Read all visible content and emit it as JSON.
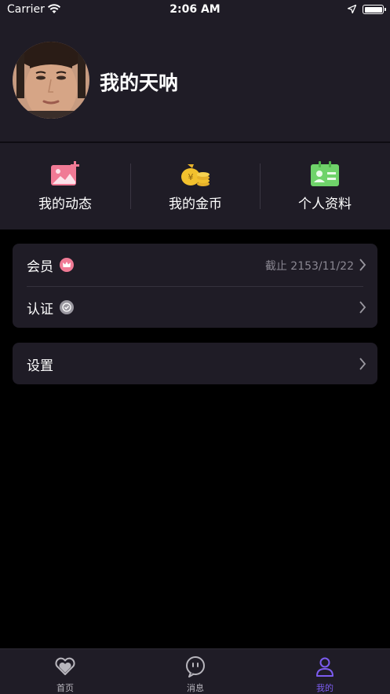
{
  "status_bar": {
    "carrier": "Carrier",
    "time": "2:06 AM"
  },
  "profile": {
    "name": "我的天呐",
    "avatar_icon": "user-avatar-photo"
  },
  "quick_actions": [
    {
      "label": "我的动态",
      "icon": "image-add-icon",
      "color": "#f07a95"
    },
    {
      "label": "我的金币",
      "icon": "coin-bag-icon",
      "color": "#f2c12e"
    },
    {
      "label": "个人资料",
      "icon": "id-card-icon",
      "color": "#6fd36a"
    }
  ],
  "menu": {
    "group1": [
      {
        "label": "会员",
        "badge_icon": "crown-icon",
        "badge_color": "#f07a95",
        "value": "截止 2153/11/22"
      },
      {
        "label": "认证",
        "badge_icon": "verified-icon",
        "badge_color": "#9a98a0",
        "value": ""
      }
    ],
    "group2": [
      {
        "label": "设置",
        "value": ""
      }
    ]
  },
  "tabbar": {
    "tabs": [
      {
        "label": "首页",
        "icon": "heart-icon",
        "active": false
      },
      {
        "label": "消息",
        "icon": "chat-bubble-icon",
        "active": false
      },
      {
        "label": "我的",
        "icon": "person-icon",
        "active": true
      }
    ],
    "active_color": "#7c5cf0",
    "inactive_color": "#b8b6bd"
  }
}
